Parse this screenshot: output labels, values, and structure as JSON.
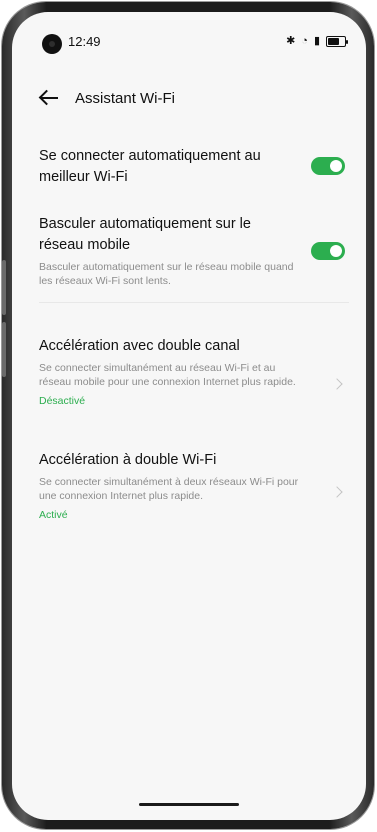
{
  "status": {
    "time": "12:49",
    "icons": [
      "bluetooth-icon",
      "wifi-icon",
      "signal-icon",
      "battery-icon"
    ]
  },
  "header": {
    "title": "Assistant Wi-Fi"
  },
  "settings": [
    {
      "title": "Se connecter automatiquement au meilleur Wi-Fi",
      "toggle": true
    },
    {
      "title": "Basculer automatiquement sur le réseau mobile",
      "subtitle": "Basculer automatiquement sur le réseau mobile quand les réseaux Wi-Fi sont lents.",
      "toggle": true
    },
    {
      "title": "Accélération avec double canal",
      "subtitle": "Se connecter simultanément au réseau Wi-Fi et au réseau mobile pour une connexion Internet plus rapide.",
      "status": "Désactivé"
    },
    {
      "title": "Accélération à double Wi-Fi",
      "subtitle": "Se connecter simultanément à deux réseaux Wi-Fi pour une connexion Internet plus rapide.",
      "status": "Activé"
    }
  ],
  "colors": {
    "accent": "#2cae4f",
    "background": "#f7f7f7"
  }
}
